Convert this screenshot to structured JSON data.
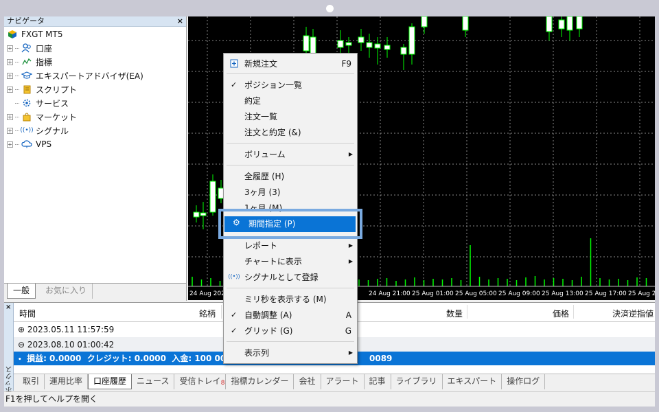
{
  "navigator": {
    "title": "ナビゲータ",
    "close": "×",
    "root": "FXGT MT5",
    "items": [
      {
        "label": "口座",
        "icon": "accounts-icon"
      },
      {
        "label": "指標",
        "icon": "indicators-icon"
      },
      {
        "label": "エキスパートアドバイザ(EA)",
        "icon": "expert-icon"
      },
      {
        "label": "スクリプト",
        "icon": "script-icon"
      },
      {
        "label": "サービス",
        "icon": "service-icon"
      },
      {
        "label": "マーケット",
        "icon": "market-icon"
      },
      {
        "label": "シグナル",
        "icon": "signal-icon"
      },
      {
        "label": "VPS",
        "icon": "vps-icon"
      }
    ],
    "tabs": [
      "一般",
      "お気に入り"
    ]
  },
  "chart": {
    "time_labels": [
      "24 Aug 202",
      "24 Aug 21:00",
      "25 Aug 01:00",
      "25 Aug 05:00",
      "25 Aug 09:00",
      "25 Aug 13:00",
      "25 Aug 17:00",
      "25 Aug 2"
    ],
    "up_color": "#00ff00",
    "background": "#000000"
  },
  "context_menu": {
    "items": [
      {
        "label": "新規注文",
        "shortcut": "F9",
        "icon": "new-order-icon"
      },
      {
        "label": "ポジション一覧",
        "check": "✓"
      },
      {
        "label": "約定"
      },
      {
        "label": "注文一覧"
      },
      {
        "label": "注文と約定 (&)"
      },
      {
        "label": "ボリューム",
        "submenu": "▶"
      },
      {
        "label": "全履歴 (H)"
      },
      {
        "label": "3ヶ月 (3)"
      },
      {
        "label": "1ヶ月 (M)"
      },
      {
        "label": "期間指定 (P)",
        "icon": "gear-icon"
      },
      {
        "label": "レポート",
        "submenu": "▶"
      },
      {
        "label": "チャートに表示",
        "submenu": "▶"
      },
      {
        "label": "シグナルとして登録",
        "icon": "signal-icon"
      },
      {
        "label": "ミリ秒を表示する (M)"
      },
      {
        "label": "自動調整 (A)",
        "shortcut": "A",
        "check": "✓"
      },
      {
        "label": "グリッド (G)",
        "shortcut": "G",
        "check": "✓"
      },
      {
        "label": "表示列",
        "submenu": "▶"
      }
    ],
    "highlight_color": "#0a74d6"
  },
  "toolbox": {
    "close": "×",
    "side_label": "ツールボックス",
    "columns": [
      "時間",
      "銘柄",
      "数量",
      "価格",
      "決済逆指値"
    ],
    "rows": [
      {
        "expander": "⊕",
        "time": "2023.05.11 11:57:59"
      },
      {
        "expander": "⊖",
        "time": "2023.08.10 01:00:42"
      }
    ],
    "summary": "損益: 0.0000  クレジット: 0.0000  入金: 100 000.000",
    "summary_tail": "0089",
    "tabs": [
      "取引",
      "運用比率",
      "口座履歴",
      "ニュース",
      "受信トレイ",
      "指標カレンダー",
      "会社",
      "アラート",
      "記事",
      "ライブラリ",
      "エキスパート",
      "操作ログ"
    ],
    "inbox_badge": "8",
    "active_tab": "口座履歴"
  },
  "status": {
    "text": "F1を押してヘルプを開く"
  }
}
